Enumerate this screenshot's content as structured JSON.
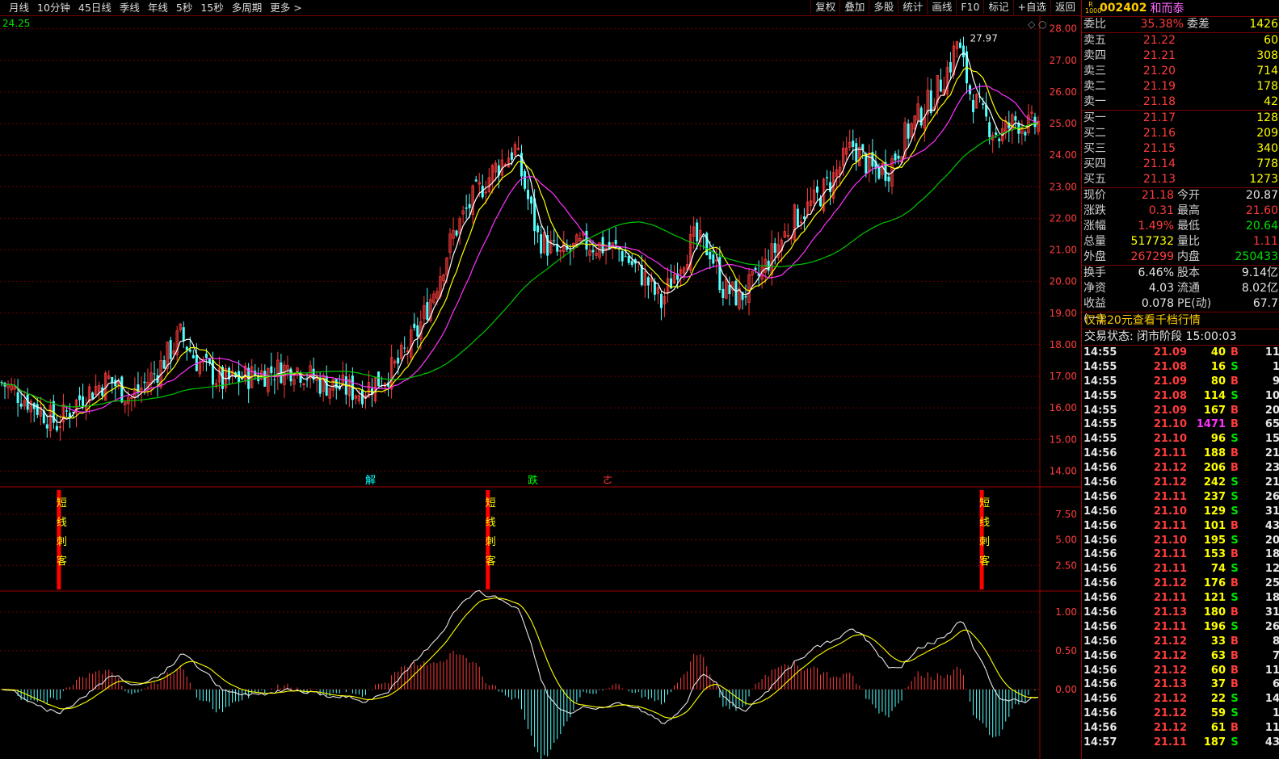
{
  "toolbar": {
    "left": [
      "月线",
      "10分钟",
      "45日线",
      "季线",
      "年线",
      "5秒",
      "15秒",
      "多周期",
      "更多 >"
    ],
    "right": [
      "复权",
      "叠加",
      "多股",
      "统计",
      "画线",
      "F10",
      "标记",
      "+自选",
      "返回"
    ]
  },
  "stock": {
    "badge_top": "R",
    "badge_bottom": "1000",
    "code": "002402",
    "name": "和而泰"
  },
  "ratio": {
    "label1": "委比",
    "value1": "35.38%",
    "label2": "委差",
    "value2": "1426"
  },
  "sells": [
    {
      "label": "卖五",
      "price": "21.22",
      "vol": "60"
    },
    {
      "label": "卖四",
      "price": "21.21",
      "vol": "308"
    },
    {
      "label": "卖三",
      "price": "21.20",
      "vol": "714"
    },
    {
      "label": "卖二",
      "price": "21.19",
      "vol": "178"
    },
    {
      "label": "卖一",
      "price": "21.18",
      "vol": "42"
    }
  ],
  "buys": [
    {
      "label": "买一",
      "price": "21.17",
      "vol": "128"
    },
    {
      "label": "买二",
      "price": "21.16",
      "vol": "209"
    },
    {
      "label": "买三",
      "price": "21.15",
      "vol": "340"
    },
    {
      "label": "买四",
      "price": "21.14",
      "vol": "778"
    },
    {
      "label": "买五",
      "price": "21.13",
      "vol": "1273"
    }
  ],
  "quote": [
    {
      "l1": "现价",
      "v1": "21.18",
      "c1": "red",
      "l2": "今开",
      "v2": "20.87",
      "c2": "white"
    },
    {
      "l1": "涨跌",
      "v1": "0.31",
      "c1": "red",
      "l2": "最高",
      "v2": "21.60",
      "c2": "red"
    },
    {
      "l1": "涨幅",
      "v1": "1.49%",
      "c1": "red",
      "l2": "最低",
      "v2": "20.64",
      "c2": "green"
    },
    {
      "l1": "总量",
      "v1": "517732",
      "c1": "yellow",
      "l2": "量比",
      "v2": "1.11",
      "c2": "red"
    },
    {
      "l1": "外盘",
      "v1": "267299",
      "c1": "red",
      "l2": "内盘",
      "v2": "250433",
      "c2": "green"
    }
  ],
  "quote2": [
    {
      "l1": "换手",
      "v1": "6.46%",
      "c1": "white",
      "l2": "股本",
      "v2": "9.14亿",
      "c2": "white"
    },
    {
      "l1": "净资",
      "v1": "4.03",
      "c1": "white",
      "l2": "流通",
      "v2": "8.02亿",
      "c2": "white"
    },
    {
      "l1": "收益(一)",
      "v1": "0.078",
      "c1": "white",
      "l2": "PE(动)",
      "v2": "67.7",
      "c2": "white"
    }
  ],
  "promo": "仅需20元查看千档行情",
  "status": "交易状态: 闭市阶段 15:00:03",
  "ticks": [
    [
      "14:55",
      "21.09",
      "40",
      "B",
      "11"
    ],
    [
      "14:55",
      "21.08",
      "16",
      "S",
      "1"
    ],
    [
      "14:55",
      "21.09",
      "80",
      "B",
      "9"
    ],
    [
      "14:55",
      "21.08",
      "114",
      "S",
      "10"
    ],
    [
      "14:55",
      "21.09",
      "167",
      "B",
      "20"
    ],
    [
      "14:55",
      "21.10",
      "1471",
      "B",
      "65"
    ],
    [
      "14:55",
      "21.10",
      "96",
      "S",
      "15"
    ],
    [
      "14:56",
      "21.11",
      "188",
      "B",
      "21"
    ],
    [
      "14:56",
      "21.12",
      "206",
      "B",
      "23"
    ],
    [
      "14:56",
      "21.12",
      "242",
      "S",
      "21"
    ],
    [
      "14:56",
      "21.11",
      "237",
      "S",
      "26"
    ],
    [
      "14:56",
      "21.10",
      "129",
      "S",
      "31"
    ],
    [
      "14:56",
      "21.11",
      "101",
      "B",
      "43"
    ],
    [
      "14:56",
      "21.10",
      "195",
      "S",
      "20"
    ],
    [
      "14:56",
      "21.11",
      "153",
      "B",
      "18"
    ],
    [
      "14:56",
      "21.11",
      "74",
      "S",
      "12"
    ],
    [
      "14:56",
      "21.12",
      "176",
      "B",
      "25"
    ],
    [
      "14:56",
      "21.11",
      "121",
      "S",
      "18"
    ],
    [
      "14:56",
      "21.13",
      "180",
      "B",
      "31"
    ],
    [
      "14:56",
      "21.11",
      "196",
      "S",
      "26"
    ],
    [
      "14:56",
      "21.12",
      "33",
      "B",
      "8"
    ],
    [
      "14:56",
      "21.12",
      "63",
      "B",
      "7"
    ],
    [
      "14:56",
      "21.12",
      "60",
      "B",
      "11"
    ],
    [
      "14:56",
      "21.13",
      "37",
      "B",
      "6"
    ],
    [
      "14:56",
      "21.12",
      "22",
      "S",
      "14"
    ],
    [
      "14:56",
      "21.12",
      "59",
      "S",
      "1"
    ],
    [
      "14:56",
      "21.12",
      "61",
      "B",
      "11"
    ],
    [
      "14:57",
      "21.11",
      "187",
      "S",
      "43"
    ]
  ],
  "colors": {
    "up": "#ff3c3c",
    "down": "#54ffff",
    "ma5": "#ffffff",
    "ma10": "#ffff00",
    "ma20": "#ff33ff",
    "ma60": "#00c800",
    "grid": "#6e0000"
  },
  "chart_data": {
    "type": "candlestick",
    "top_left_value": "24.25",
    "max_label": "27.97",
    "yaxis_ticks": [
      "28.00",
      "27.00",
      "26.00",
      "25.00",
      "24.00",
      "23.00",
      "22.00",
      "21.00",
      "20.00",
      "19.00",
      "18.00",
      "17.00",
      "16.00",
      "15.00",
      "14.00"
    ],
    "ylim": [
      13.5,
      28.4
    ],
    "waypoints": [
      [
        0,
        16.8
      ],
      [
        10,
        16.1
      ],
      [
        17,
        15.5
      ],
      [
        25,
        16.4
      ],
      [
        33,
        16.9
      ],
      [
        40,
        16.3
      ],
      [
        48,
        17.2
      ],
      [
        55,
        18.3
      ],
      [
        60,
        17.5
      ],
      [
        68,
        16.8
      ],
      [
        80,
        17.1
      ],
      [
        90,
        17.3
      ],
      [
        98,
        16.8
      ],
      [
        110,
        16.5
      ],
      [
        118,
        17.0
      ],
      [
        122,
        17.4
      ],
      [
        128,
        18.4
      ],
      [
        134,
        20.0
      ],
      [
        139,
        21.5
      ],
      [
        145,
        22.6
      ],
      [
        152,
        23.6
      ],
      [
        158,
        24.2
      ],
      [
        162,
        22.6
      ],
      [
        165,
        21.4
      ],
      [
        172,
        20.8
      ],
      [
        180,
        21.2
      ],
      [
        190,
        21.0
      ],
      [
        198,
        20.1
      ],
      [
        203,
        19.3
      ],
      [
        208,
        20.5
      ],
      [
        213,
        21.3
      ],
      [
        218,
        21.0
      ],
      [
        222,
        19.8
      ],
      [
        227,
        19.5
      ],
      [
        232,
        20.0
      ],
      [
        238,
        21.0
      ],
      [
        244,
        22.0
      ],
      [
        250,
        22.5
      ],
      [
        256,
        23.3
      ],
      [
        262,
        24.3
      ],
      [
        268,
        23.5
      ],
      [
        273,
        23.6
      ],
      [
        278,
        24.6
      ],
      [
        282,
        25.2
      ],
      [
        287,
        25.9
      ],
      [
        292,
        26.9
      ],
      [
        294,
        27.6
      ],
      [
        298,
        26.0
      ],
      [
        302,
        25.2
      ],
      [
        307,
        24.6
      ],
      [
        312,
        25.1
      ],
      [
        316,
        24.9
      ],
      [
        319,
        25.0
      ]
    ],
    "indicator": {
      "labels": [
        "7.50",
        "5.00",
        "2.50"
      ],
      "ylim": [
        0,
        10
      ],
      "signals": [
        {
          "index": 18,
          "text": [
            "短",
            "线",
            "刺",
            "客"
          ]
        },
        {
          "index": 150,
          "text": [
            "短",
            "线",
            "刺",
            "客"
          ]
        },
        {
          "index": 302,
          "text": [
            "短",
            "线",
            "刺",
            "客"
          ]
        }
      ]
    },
    "event_markers": [
      {
        "index": 114,
        "text": "解",
        "color": "#00ffff"
      },
      {
        "index": 164,
        "text": "跌",
        "color": "#00ff00"
      },
      {
        "index": 187,
        "text": "ㄜ",
        "color": "#ff3333"
      }
    ],
    "macd": {
      "labels": [
        "1.00",
        "0.50",
        "0.00"
      ],
      "ylim": [
        -0.9,
        1.25
      ]
    }
  }
}
